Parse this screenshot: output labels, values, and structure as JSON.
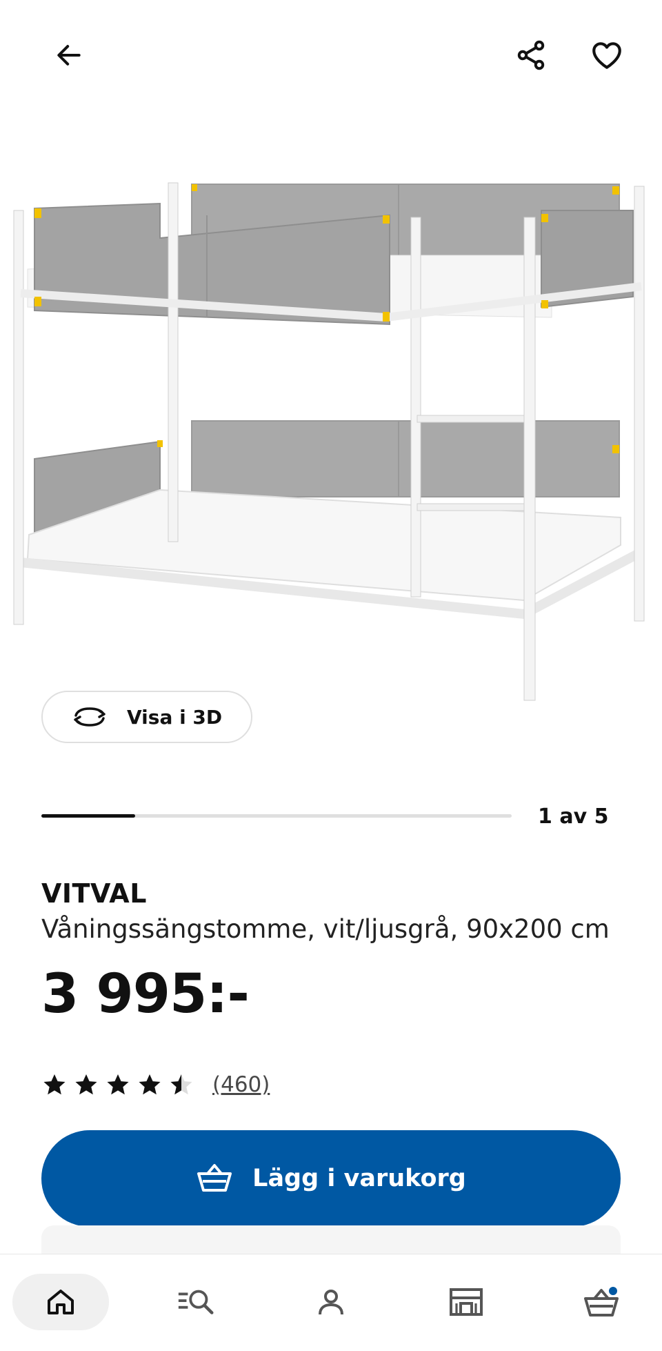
{
  "header": {
    "back_icon": "arrow-left-icon",
    "share_icon": "share-icon",
    "favorite_icon": "heart-icon"
  },
  "view3d": {
    "label": "Visa i 3D",
    "icon": "rotate-3d-icon"
  },
  "gallery": {
    "progress_text": "1 av 5",
    "current": 1,
    "total": 5
  },
  "product": {
    "name": "VITVAL",
    "description": "Våningssängstomme, vit/ljusgrå, 90x200 cm",
    "price": "3 995:-",
    "rating": 4.5,
    "review_count": "(460)"
  },
  "cart": {
    "add_label": "Lägg i varukorg",
    "icon": "basket-icon"
  },
  "bottom_nav": [
    {
      "name": "home",
      "icon": "home-icon",
      "active": true
    },
    {
      "name": "search",
      "icon": "search-list-icon"
    },
    {
      "name": "profile",
      "icon": "person-icon"
    },
    {
      "name": "stores",
      "icon": "store-icon"
    },
    {
      "name": "cart",
      "icon": "cart-basket-icon",
      "badge": true
    }
  ],
  "colors": {
    "primary": "#0058a3",
    "text": "#111111",
    "badge": "#0058a3",
    "yellow_corner": "#f2c200"
  }
}
